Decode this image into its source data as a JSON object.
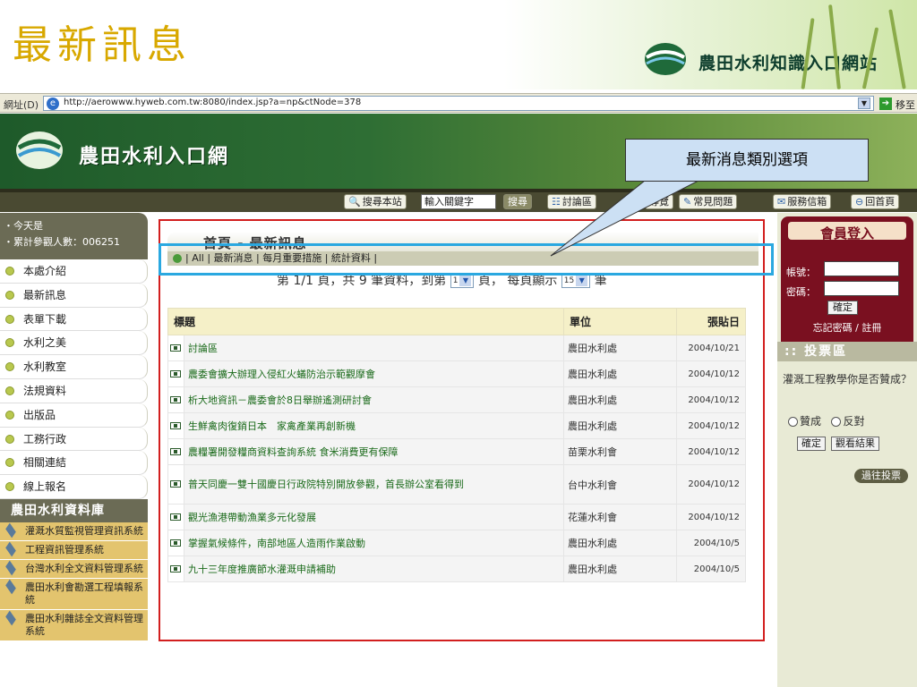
{
  "slide": {
    "title": "最新訊息",
    "site_name": "農田水利知識入口網站"
  },
  "address_bar": {
    "label": "網址(D)",
    "url": "http://aerowww.hyweb.com.tw:8080/index.jsp?a=np&ctNode=378",
    "go_label": "移至"
  },
  "header": {
    "site_name": "農田水利入口網"
  },
  "toolbar": {
    "search_site": "搜尋本站",
    "keyword_placeholder": "輸入關鍵字",
    "search_button": "搜尋",
    "forum": "討論區",
    "overview_suffix": "導覽",
    "faq": "常見問題",
    "mailbox": "服務信箱",
    "home": "回首頁"
  },
  "left_nav": {
    "today_label": "今天是",
    "visitors_label": "累計參觀人數：006251",
    "items": [
      "本處介紹",
      "最新訊息",
      "表單下載",
      "水利之美",
      "水利教室",
      "法規資料",
      "出版品",
      "工務行政",
      "相關連結",
      "線上報名"
    ],
    "db_title": "農田水利資料庫",
    "db_items": [
      "灌溉水質監視管理資訊系統",
      "工程資訊管理系統",
      "台灣水利全文資料管理系統",
      "農田水利會勘選工程填報系統",
      "農田水利雜誌全文資料管理系統"
    ]
  },
  "content": {
    "breadcrumb": "首頁 - 最新訊息",
    "filter": "| All | 最新消息 | 每月重要措施 | 統計資料 |",
    "pager_text_a": "第 1/1 頁，共 9 筆資料，到第",
    "pager_page": "1",
    "pager_text_b": "頁， 每頁顯示",
    "pager_size": "15",
    "pager_text_c": "筆",
    "columns": [
      "標題",
      "單位",
      "張貼日"
    ],
    "rows": [
      {
        "title": "討論區",
        "unit": "農田水利處",
        "date": "2004/10/21"
      },
      {
        "title": "農委會擴大辦理入侵紅火蟻防治示範觀摩會",
        "unit": "農田水利處",
        "date": "2004/10/12"
      },
      {
        "title": "析大地資訊－農委會於8日舉辦遙測研討會",
        "unit": "農田水利處",
        "date": "2004/10/12"
      },
      {
        "title": "生鮮禽肉復銷日本　家禽產業再創新機",
        "unit": "農田水利處",
        "date": "2004/10/12"
      },
      {
        "title": "農糧署開發糧商資料查詢系統 食米消費更有保障",
        "unit": "苗栗水利會",
        "date": "2004/10/12"
      },
      {
        "title": "普天同慶一雙十國慶日行政院特別開放參觀，首長辦公室看得到",
        "unit": "台中水利會",
        "date": "2004/10/12"
      },
      {
        "title": "觀光漁港帶動漁業多元化發展",
        "unit": "花蓮水利會",
        "date": "2004/10/12"
      },
      {
        "title": "掌握氣候條件，南部地區人造雨作業啟動",
        "unit": "農田水利處",
        "date": "2004/10/5"
      },
      {
        "title": "九十三年度推廣節水灌溉申請補助",
        "unit": "農田水利處",
        "date": "2004/10/5"
      }
    ]
  },
  "member": {
    "title": "會員登入",
    "account_label": "帳號：",
    "password_label": "密碼：",
    "ok": "確定",
    "links": "忘記密碼 / 註冊"
  },
  "vote": {
    "title": ":: 投票區",
    "question": "灌溉工程教學你是否贊成？",
    "option_yes": "贊成",
    "option_no": "反對",
    "ok": "確定",
    "view_results": "觀看結果",
    "past": "過往投票"
  },
  "annotation": {
    "callout": "最新消息類別選項"
  }
}
